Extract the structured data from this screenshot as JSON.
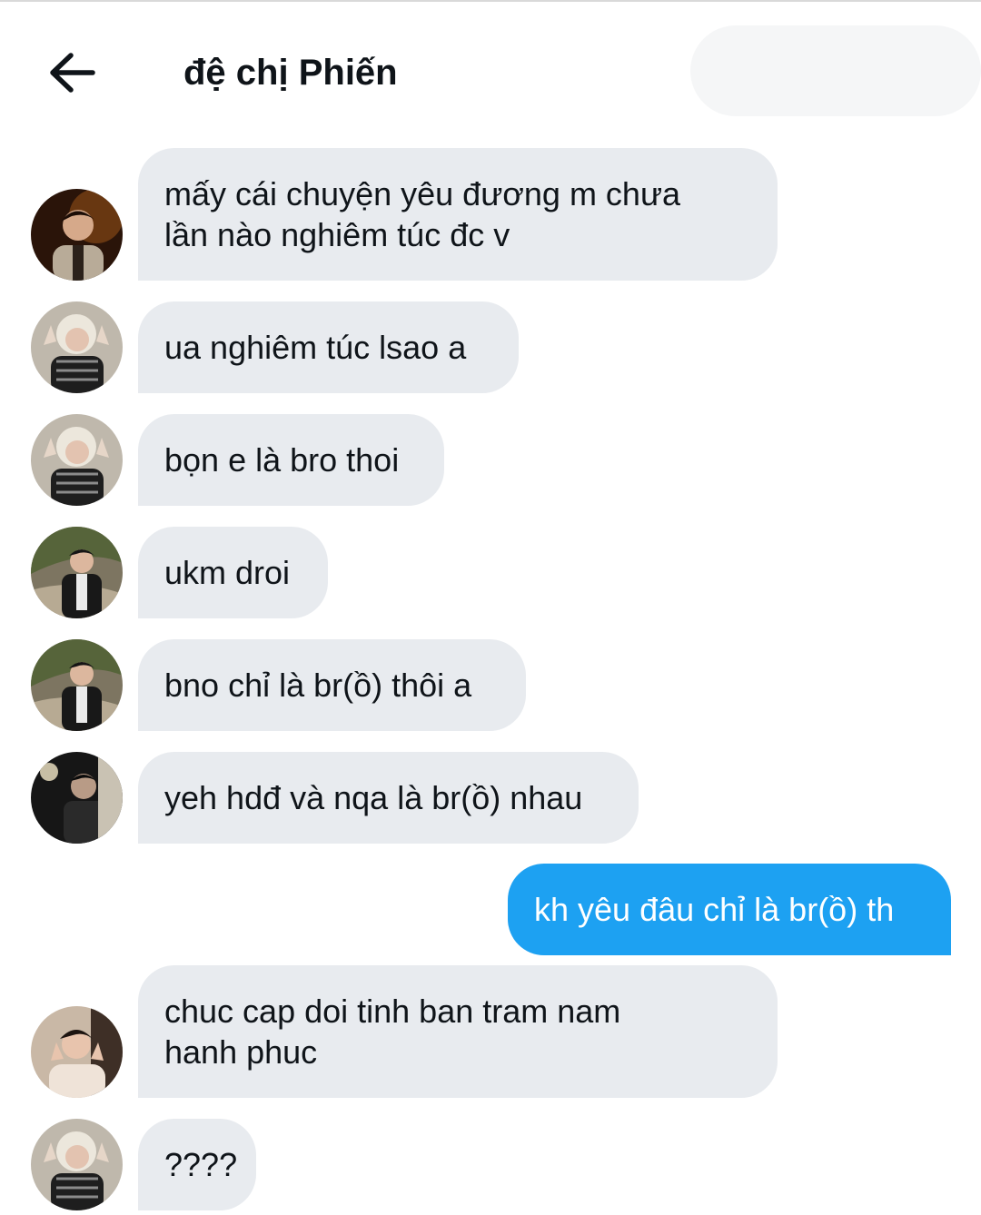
{
  "header": {
    "title": "đệ chị Phiến",
    "back_icon": "arrow-left-icon"
  },
  "colors": {
    "incoming_bubble": "#e8ebef",
    "outgoing_bubble": "#1da1f2",
    "text": "#0f1419"
  },
  "messages": [
    {
      "direction": "incoming",
      "avatar": "avatar-sender-1",
      "text": "mấy cái chuyện yêu đương m chưa\nlần nào nghiêm túc đc v"
    },
    {
      "direction": "incoming",
      "avatar": "avatar-sender-2",
      "text": "ua nghiêm túc lsao a"
    },
    {
      "direction": "incoming",
      "avatar": "avatar-sender-2",
      "text": "bọn e là bro thoi"
    },
    {
      "direction": "incoming",
      "avatar": "avatar-sender-3",
      "text": "ukm droi"
    },
    {
      "direction": "incoming",
      "avatar": "avatar-sender-3",
      "text": "bno chỉ là br(ồ) thôi a"
    },
    {
      "direction": "incoming",
      "avatar": "avatar-sender-4",
      "text": "yeh hdđ và nqa là br(ồ) nhau"
    },
    {
      "direction": "outgoing",
      "text": "kh yêu đâu chỉ là br(ồ) th"
    },
    {
      "direction": "incoming",
      "avatar": "avatar-sender-5",
      "text": "chuc cap doi tinh ban tram nam\nhanh phuc"
    },
    {
      "direction": "incoming",
      "avatar": "avatar-sender-2",
      "text": "????"
    }
  ]
}
